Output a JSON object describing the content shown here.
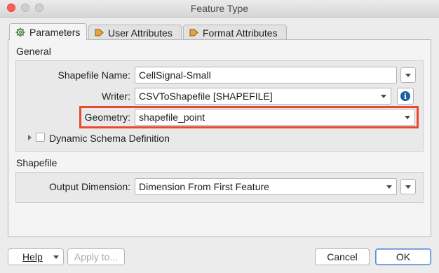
{
  "window": {
    "title": "Feature Type"
  },
  "tabs": [
    {
      "label": "Parameters",
      "icon": "gear-icon",
      "active": true
    },
    {
      "label": "User Attributes",
      "icon": "attribute-arrow-icon",
      "active": false
    },
    {
      "label": "Format Attributes",
      "icon": "attribute-arrow-icon",
      "active": false
    }
  ],
  "general": {
    "section_title": "General",
    "shapefile_name": {
      "label": "Shapefile Name:",
      "value": "CellSignal-Small"
    },
    "writer": {
      "label": "Writer:",
      "value": "CSVToShapefile [SHAPEFILE]"
    },
    "geometry": {
      "label": "Geometry:",
      "value": "shapefile_point"
    },
    "dynamic_schema": {
      "label": "Dynamic Schema Definition",
      "checked": false
    }
  },
  "shapefile": {
    "section_title": "Shapefile",
    "output_dimension": {
      "label": "Output Dimension:",
      "value": "Dimension From First Feature"
    }
  },
  "footer": {
    "help_label": "Help",
    "apply_label": "Apply to...",
    "cancel_label": "Cancel",
    "ok_label": "OK"
  },
  "colors": {
    "highlight": "#e8492f",
    "info": "#1a62a6",
    "accent": "#5b8fd3"
  }
}
